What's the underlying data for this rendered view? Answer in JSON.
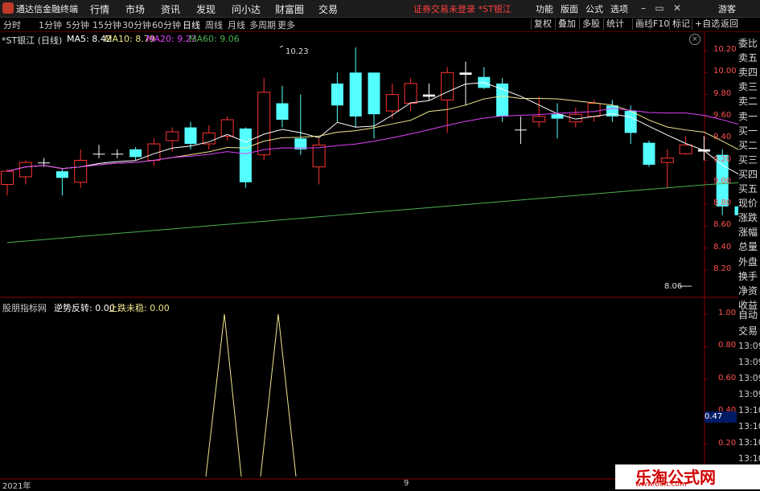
{
  "titlebar": {
    "app_title": "通达信金融终端",
    "menus": [
      "行情",
      "市场",
      "资讯",
      "发现",
      "问小达",
      "财富圈",
      "交易"
    ],
    "status": "证券交易未登录 *ST银江",
    "right_menus": [
      "功能",
      "版面",
      "公式",
      "选项"
    ],
    "user": "游客"
  },
  "toolbar": {
    "timeframes": [
      "分时",
      "1分钟",
      "5分钟",
      "15分钟",
      "30分钟",
      "60分钟",
      "日线",
      "周线",
      "月线",
      "多周期",
      "更多"
    ],
    "active_timeframe": "日线",
    "buttons": [
      "复权",
      "叠加",
      "多股",
      "统计",
      "画线",
      "F10",
      "标记",
      "+自选",
      "返回"
    ]
  },
  "chart": {
    "stock_name": "*ST银江 (日线)",
    "ma": [
      {
        "label": "MA5: 8.42",
        "color": "#ffffff"
      },
      {
        "label": "MA10: 8.79",
        "color": "#f0e68c"
      },
      {
        "label": "MA20: 9.23",
        "color": "#e040fb"
      },
      {
        "label": "MA60: 9.06",
        "color": "#4caf50"
      }
    ],
    "high_label": "10.23",
    "low_label": "8.06",
    "y_ticks": [
      "10.20",
      "10.00",
      "9.80",
      "9.60",
      "9.40",
      "9.20",
      "9.00",
      "8.80",
      "8.60",
      "8.40",
      "8.20"
    ],
    "colors": {
      "up": "#ff3232",
      "down": "#54ffff",
      "grid": "#8b0000"
    }
  },
  "indicator": {
    "title": "股朋指标网",
    "v1": "逆势反转: 0.00",
    "v2": "止跌未稳: 0.00",
    "y_ticks": [
      "1.00",
      "0.80",
      "0.60",
      "0.40",
      "0.20"
    ],
    "current": "0.47"
  },
  "right_panel": {
    "labels": [
      "委比",
      "卖五",
      "卖四",
      "卖三",
      "卖二",
      "卖一",
      "买一",
      "买二",
      "买三",
      "买四",
      "买五",
      "现价",
      "涨跌",
      "涨幅",
      "总量",
      "外盘",
      "换手",
      "净资",
      "收益"
    ],
    "lower": [
      "自动",
      "交易"
    ],
    "times": [
      "13:09",
      "13:09",
      "13:09",
      "13:09",
      "13:10",
      "13:10",
      "13:10",
      "13:10",
      "13:10"
    ]
  },
  "footer": {
    "year": "2021年",
    "mark": "9"
  },
  "watermark": {
    "title": "乐淘公式网",
    "url": "www.60lt.com"
  }
}
